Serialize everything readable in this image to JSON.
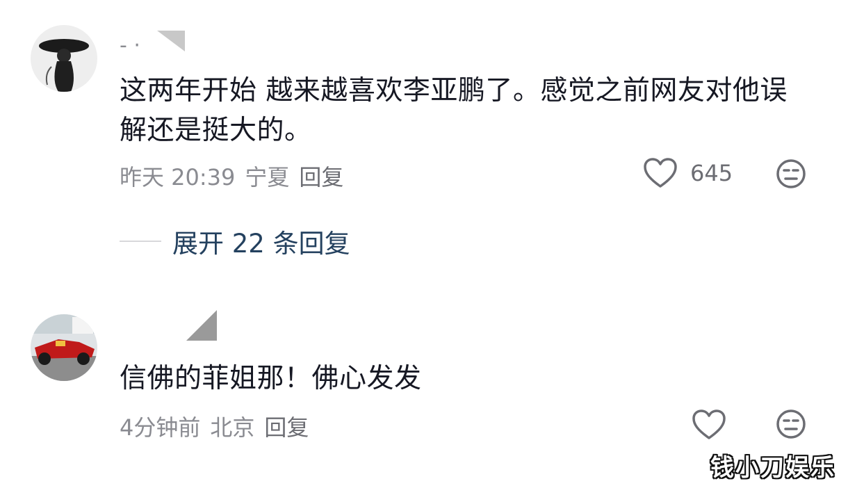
{
  "comments": [
    {
      "username": "- ·",
      "text": "这两年开始 越来越喜欢李亚鹏了。感觉之前网友对他误解还是挺大的。",
      "time": "昨天 20:39",
      "location": "宁夏",
      "reply_label": "回复",
      "like_count": "645",
      "avatar_icon": "silhouette-avatar",
      "expand_label": "展开 22 条回复"
    },
    {
      "username": "",
      "text": "信佛的菲姐那！佛心发发",
      "time": "4分钟前",
      "location": "北京",
      "reply_label": "回复",
      "like_count": "",
      "avatar_icon": "race-car-avatar"
    }
  ],
  "icons": {
    "like": "heart-icon",
    "dislike": "neutral-face-icon"
  },
  "watermark": "钱小刀娱乐",
  "colors": {
    "text": "#161823",
    "meta": "#8a8b91",
    "expand": "#24415f"
  }
}
